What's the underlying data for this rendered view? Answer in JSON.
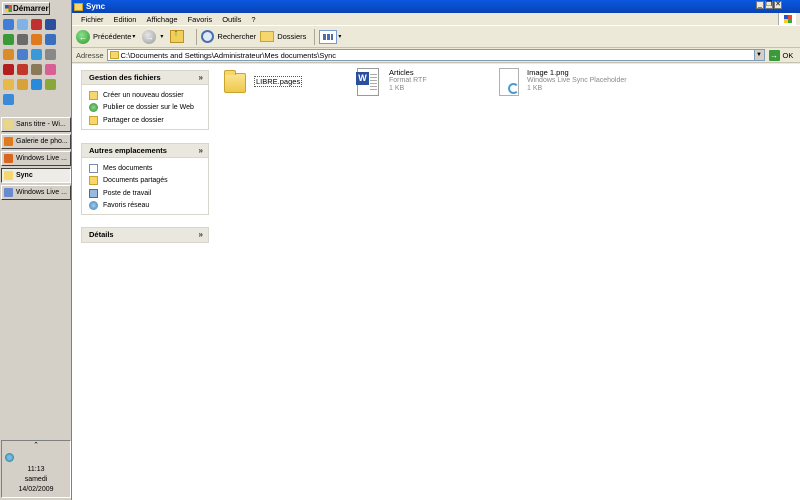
{
  "taskbar": {
    "start_label": "Démarrer",
    "quicklaunch": [
      {
        "icon": "internet-explorer-icon",
        "color": "#3f7fd8"
      },
      {
        "icon": "bulb-icon",
        "color": "#7fb3e8"
      },
      {
        "icon": "pen-icon",
        "color": "#c03030"
      },
      {
        "icon": "word-icon",
        "color": "#2a4f9e"
      },
      {
        "icon": "globe-icon",
        "color": "#3a9a3a"
      },
      {
        "icon": "camera-icon",
        "color": "#6a6a6a"
      },
      {
        "icon": "firefox-icon",
        "color": "#e07a1f"
      },
      {
        "icon": "mail-icon",
        "color": "#3a6fc0"
      },
      {
        "icon": "photo-icon",
        "color": "#d98c2b"
      },
      {
        "icon": "movie-icon",
        "color": "#4a7fd0"
      },
      {
        "icon": "refresh-icon",
        "color": "#3a9ad9"
      },
      {
        "icon": "calculator-icon",
        "color": "#888888"
      },
      {
        "icon": "flash-icon",
        "color": "#b51e1e"
      },
      {
        "icon": "pdf-icon",
        "color": "#c0392b"
      },
      {
        "icon": "gimp-icon",
        "color": "#8a7a5a"
      },
      {
        "icon": "paint-icon",
        "color": "#d95f95"
      },
      {
        "icon": "folder-icon",
        "color": "#e6b94a"
      },
      {
        "icon": "tools-icon",
        "color": "#d9a13a"
      },
      {
        "icon": "pencil-icon",
        "color": "#2a8ad9"
      },
      {
        "icon": "feather-icon",
        "color": "#8aa83a"
      },
      {
        "icon": "sync-icon",
        "color": "#3a8ad9"
      }
    ],
    "tasks": [
      {
        "label": "Sans titre - Wi...",
        "icon": "notepad-icon",
        "color": "#e8d68a",
        "active": false
      },
      {
        "label": "Galerie de pho...",
        "icon": "photo-gallery-icon",
        "color": "#e07a1f",
        "active": false
      },
      {
        "label": "Windows Live ...",
        "icon": "firefox-icon",
        "color": "#d9651f",
        "active": false
      },
      {
        "label": "Sync",
        "icon": "folder-icon",
        "color": "#f5d76e",
        "active": true
      },
      {
        "label": "Windows Live ...",
        "icon": "word-icon",
        "color": "#6a8ad0",
        "active": false
      }
    ],
    "tray": {
      "toggle": "⌃",
      "time": "11:13",
      "day": "samedi",
      "date": "14/02/2009"
    }
  },
  "window": {
    "title": "Sync",
    "menus": [
      "Fichier",
      "Edition",
      "Affichage",
      "Favoris",
      "Outils",
      "?"
    ],
    "controls": {
      "minimize": "_",
      "restore": "❐",
      "close": "✕"
    },
    "toolbar": {
      "back": "Précédente",
      "search": "Rechercher",
      "folders": "Dossiers"
    },
    "address": {
      "label": "Adresse",
      "path": "C:\\Documents and Settings\\Administrateur\\Mes documents\\Sync",
      "go": "OK"
    }
  },
  "taskpane": {
    "file_tasks": {
      "title": "Gestion des fichiers",
      "items": [
        {
          "label": "Créer un nouveau dossier",
          "icon": "new-folder-icon"
        },
        {
          "label": "Publier ce dossier sur le Web",
          "icon": "publish-web-icon"
        },
        {
          "label": "Partager ce dossier",
          "icon": "share-folder-icon"
        }
      ]
    },
    "other_places": {
      "title": "Autres emplacements",
      "items": [
        {
          "label": "Mes documents",
          "icon": "my-documents-icon"
        },
        {
          "label": "Documents partagés",
          "icon": "shared-documents-icon"
        },
        {
          "label": "Poste de travail",
          "icon": "my-computer-icon"
        },
        {
          "label": "Favoris réseau",
          "icon": "network-places-icon"
        }
      ]
    },
    "details": {
      "title": "Détails"
    }
  },
  "files": [
    {
      "name": "LIBRE.pages",
      "type": "folder",
      "icon": "folder-icon"
    },
    {
      "name": "Articles",
      "type": "Format RTF",
      "size": "1 KB",
      "icon": "word-document-icon"
    },
    {
      "name": "Image 1.png",
      "type": "Windows Live Sync Placeholder",
      "size": "1 KB",
      "icon": "sync-placeholder-icon"
    }
  ]
}
